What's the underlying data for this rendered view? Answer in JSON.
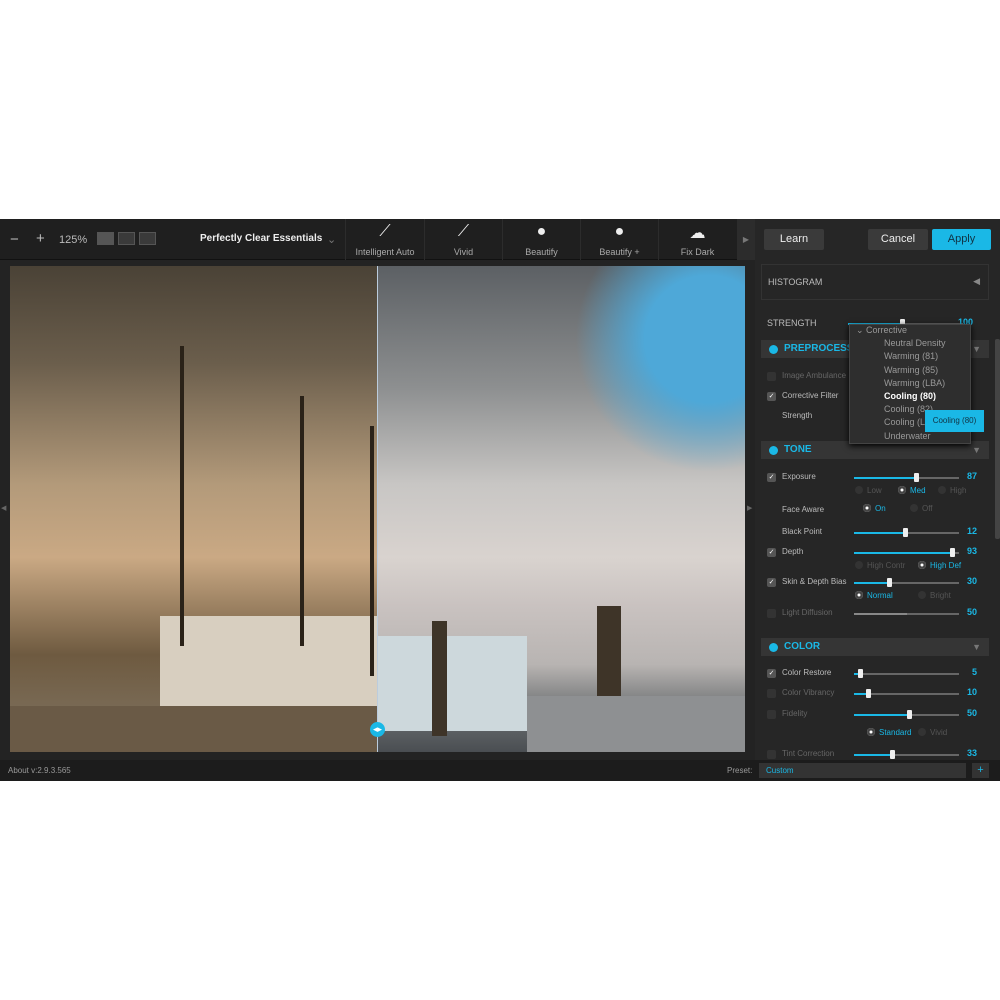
{
  "toolbar": {
    "zoom_out": "−",
    "zoom_in": "+",
    "zoom_level": "125%",
    "preset_group": "Perfectly Clear Essentials",
    "presets": [
      {
        "label": "Intelligent Auto",
        "icon": "wand-icon"
      },
      {
        "label": "Vivid",
        "icon": "brush-icon"
      },
      {
        "label": "Beautify",
        "icon": "face-icon"
      },
      {
        "label": "Beautify +",
        "icon": "face-plus-icon"
      },
      {
        "label": "Fix Dark",
        "icon": "cloud-icon"
      }
    ]
  },
  "actions": {
    "learn": "Learn",
    "cancel": "Cancel",
    "apply": "Apply"
  },
  "panel": {
    "histogram": "HISTOGRAM",
    "strength_label": "STRENGTH",
    "strength_value": "100",
    "preprocessing": {
      "title": "PREPROCESSING",
      "image_ambulance": "Image Ambulance",
      "corrective_filter": "Corrective Filter",
      "strength": "Strength"
    },
    "dropdown": {
      "group": "Corrective",
      "items": [
        "Neutral Density",
        "Warming (81)",
        "Warming (85)",
        "Warming (LBA)",
        "Cooling (80)",
        "Cooling (82)",
        "Cooling (LBB)",
        "Underwater"
      ],
      "selected": "Cooling (80)",
      "tooltip": "Cooling (80)"
    },
    "tone": {
      "title": "TONE",
      "exposure": {
        "label": "Exposure",
        "value": 87
      },
      "exposure_modes": [
        "Low",
        "Med",
        "High"
      ],
      "exposure_mode": "Med",
      "face_aware": {
        "label": "Face Aware",
        "on": "On",
        "off": "Off"
      },
      "black_point": {
        "label": "Black Point",
        "value": 12
      },
      "depth": {
        "label": "Depth",
        "value": 93
      },
      "depth_modes": [
        "High Contr",
        "High Def"
      ],
      "skin_depth_bias": {
        "label": "Skin & Depth Bias",
        "value": 30
      },
      "bias_modes": [
        "Normal",
        "Bright"
      ],
      "light_diffusion": {
        "label": "Light Diffusion",
        "value": 50
      }
    },
    "color": {
      "title": "COLOR",
      "color_restore": {
        "label": "Color Restore",
        "value": 5
      },
      "color_vibrancy": {
        "label": "Color Vibrancy",
        "value": 10
      },
      "fidelity": {
        "label": "Fidelity",
        "value": 50
      },
      "fidelity_modes": [
        "Standard",
        "Vivid"
      ],
      "tint_correction": {
        "label": "Tint Correction",
        "value": 33
      }
    }
  },
  "status": {
    "about": "About v:2.9.3.565",
    "preset_label": "Preset:",
    "preset_value": "Custom",
    "add": "+"
  },
  "accent": "#1ab8e6"
}
